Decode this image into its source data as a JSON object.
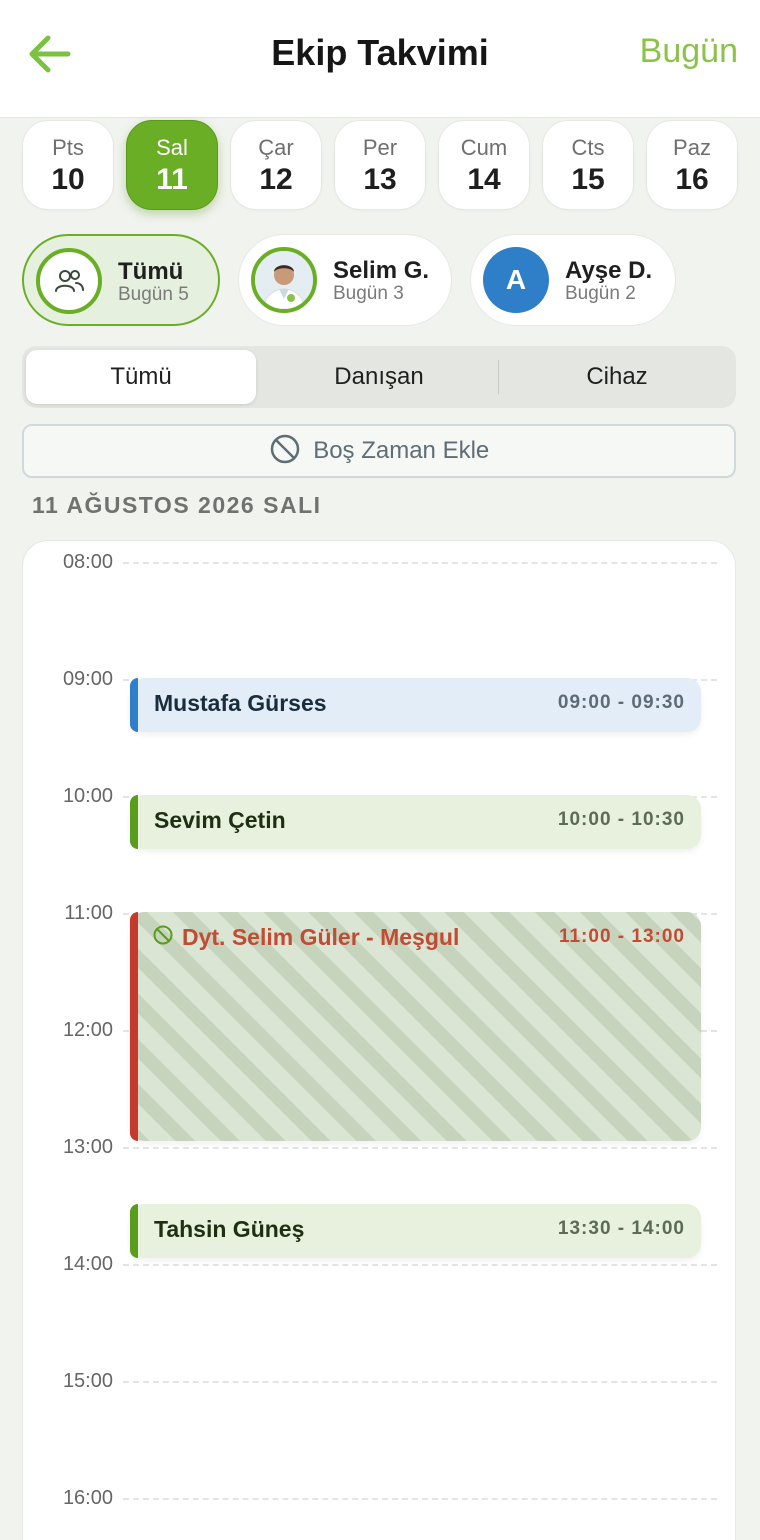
{
  "header": {
    "title": "Ekip Takvimi",
    "today_label": "Bugün"
  },
  "days": [
    {
      "name": "Pts",
      "num": "10",
      "selected": false
    },
    {
      "name": "Sal",
      "num": "11",
      "selected": true
    },
    {
      "name": "Çar",
      "num": "12",
      "selected": false
    },
    {
      "name": "Per",
      "num": "13",
      "selected": false
    },
    {
      "name": "Cum",
      "num": "14",
      "selected": false
    },
    {
      "name": "Cts",
      "num": "15",
      "selected": false
    },
    {
      "name": "Paz",
      "num": "16",
      "selected": false
    }
  ],
  "staff": [
    {
      "name": "Tümü",
      "sub": "Bugün 5",
      "active": true,
      "avatar": "users-icon"
    },
    {
      "name": "Selim G.",
      "sub": "Bugün 3",
      "active": false,
      "avatar": "photo"
    },
    {
      "name": "Ayşe D.",
      "sub": "Bugün 2",
      "active": false,
      "avatar_letter": "A"
    }
  ],
  "segments": [
    {
      "label": "Tümü",
      "active": true
    },
    {
      "label": "Danışan",
      "active": false
    },
    {
      "label": "Cihaz",
      "active": false
    }
  ],
  "add_free_label": "Boş Zaman Ekle",
  "date_heading": "11 AĞUSTOS 2026 SALI",
  "hours": [
    "08:00",
    "09:00",
    "10:00",
    "11:00",
    "12:00",
    "13:00",
    "14:00",
    "15:00",
    "16:00"
  ],
  "events": [
    {
      "title": "Mustafa Gürses",
      "time": "09:00 - 09:30",
      "kind": "blue"
    },
    {
      "title": "Sevim Çetin",
      "time": "10:00 - 10:30",
      "kind": "green"
    },
    {
      "title": "Dyt. Selim Güler - Meşgul",
      "time": "11:00 - 13:00",
      "kind": "busy"
    },
    {
      "title": "Tahsin Güneş",
      "time": "13:30 - 14:00",
      "kind": "green"
    }
  ],
  "colors": {
    "accent": "#6aae25",
    "link": "#8bc34a",
    "blue": "#2f7fc8",
    "busy": "#c63a2e"
  }
}
